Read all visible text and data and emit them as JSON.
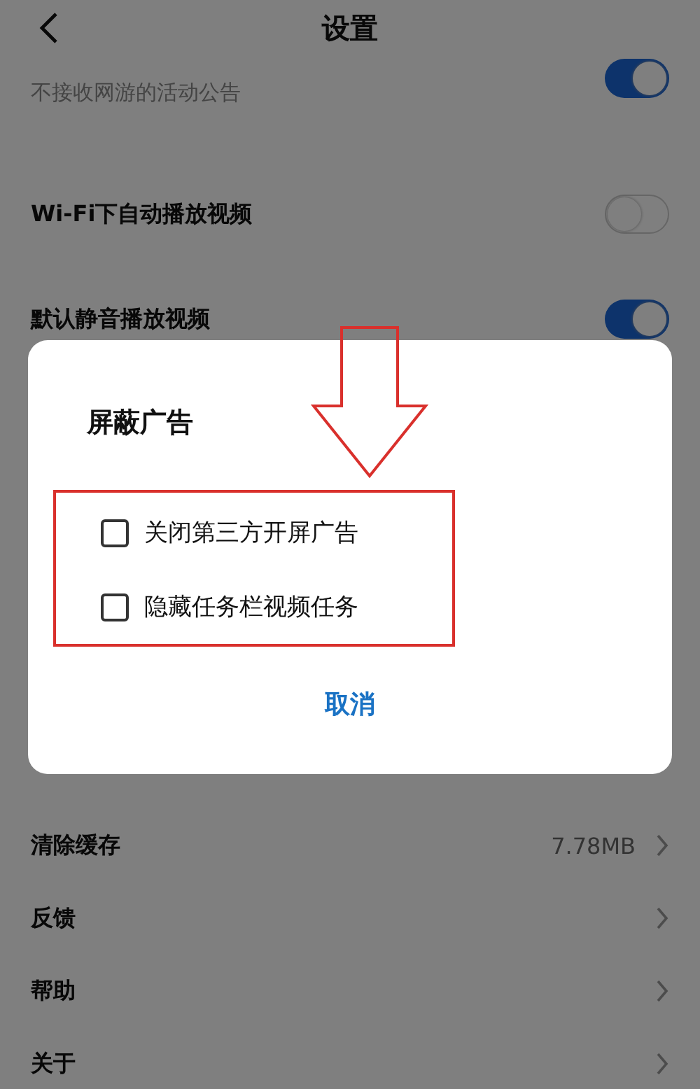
{
  "header": {
    "title": "设置"
  },
  "top_settings": [
    {
      "kind": "toggle",
      "subtitle": "不接收网游的活动公告",
      "on": true
    },
    {
      "kind": "toggle",
      "label": "Wi-Fi下自动播放视频",
      "on": false
    },
    {
      "kind": "toggle",
      "label": "默认静音播放视频",
      "on": true
    }
  ],
  "bottom_settings": [
    {
      "kind": "nav",
      "label": "清除缓存",
      "value": "7.78MB"
    },
    {
      "kind": "nav",
      "label": "反馈"
    },
    {
      "kind": "nav",
      "label": "帮助"
    },
    {
      "kind": "nav",
      "label": "关于"
    }
  ],
  "dialog": {
    "title": "屏蔽广告",
    "options": [
      {
        "label": "关闭第三方开屏广告",
        "checked": false
      },
      {
        "label": "隐藏任务栏视频任务",
        "checked": false
      }
    ],
    "cancel": "取消"
  }
}
